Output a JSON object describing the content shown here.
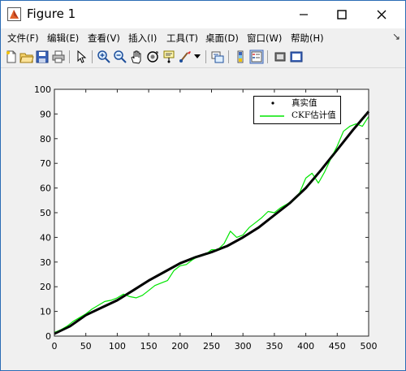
{
  "window": {
    "title": "Figure 1"
  },
  "menu": [
    {
      "label": "文件(F)"
    },
    {
      "label": "编辑(E)"
    },
    {
      "label": "查看(V)"
    },
    {
      "label": "插入(I)"
    },
    {
      "label": "工具(T)"
    },
    {
      "label": "桌面(D)"
    },
    {
      "label": "窗口(W)"
    },
    {
      "label": "帮助(H)"
    }
  ],
  "toolbar_icons": [
    "new-figure-icon",
    "open-file-icon",
    "save-icon",
    "print-icon",
    "pointer-icon",
    "zoom-in-icon",
    "zoom-out-icon",
    "pan-hand-icon",
    "rotate-3d-icon",
    "data-cursor-icon",
    "brush-icon",
    "link-plot-icon",
    "colorbar-icon",
    "legend-icon",
    "hide-plot-tools-icon",
    "show-plot-tools-icon"
  ],
  "colors": {
    "true_series": "#000000",
    "ckf_series": "#00e600",
    "window_border": "#2b6cb5"
  },
  "chart_data": {
    "type": "line",
    "xlim": [
      0,
      500
    ],
    "ylim": [
      0,
      100
    ],
    "x_ticks": [
      0,
      50,
      100,
      150,
      200,
      250,
      300,
      350,
      400,
      450,
      500
    ],
    "y_ticks": [
      0,
      10,
      20,
      30,
      40,
      50,
      60,
      70,
      80,
      90,
      100
    ],
    "legend_position": "top-right",
    "series": [
      {
        "name": "真实值",
        "color": "#000000",
        "marker": "dot",
        "x": [
          0,
          25,
          50,
          75,
          100,
          125,
          150,
          175,
          200,
          225,
          250,
          275,
          300,
          325,
          350,
          375,
          400,
          425,
          450,
          475,
          500
        ],
        "y": [
          1,
          4,
          8.5,
          11.5,
          14.5,
          18.5,
          22.5,
          26,
          29.5,
          32,
          34,
          36.5,
          40,
          44,
          49,
          54,
          60,
          67.5,
          75.5,
          83.5,
          91
        ]
      },
      {
        "name": "CKF估计值",
        "color": "#00e600",
        "marker": "line",
        "x": [
          0,
          10,
          20,
          30,
          40,
          50,
          60,
          70,
          80,
          90,
          100,
          110,
          120,
          130,
          140,
          150,
          160,
          170,
          180,
          190,
          200,
          210,
          220,
          230,
          240,
          250,
          260,
          270,
          280,
          290,
          300,
          310,
          320,
          330,
          340,
          350,
          360,
          370,
          380,
          390,
          400,
          410,
          420,
          430,
          440,
          450,
          460,
          470,
          480,
          490,
          500
        ],
        "y": [
          1.5,
          2.5,
          4,
          6,
          7.5,
          9,
          11,
          12.5,
          14,
          14.5,
          15.5,
          17,
          16,
          15.5,
          16.5,
          18.5,
          20.5,
          21.5,
          22.5,
          26.5,
          28.5,
          29,
          31,
          32.5,
          33,
          35,
          35,
          37.5,
          42.5,
          40,
          41,
          44,
          46,
          48,
          50.5,
          50,
          52,
          53.5,
          55,
          58,
          64,
          66,
          62,
          66.5,
          72,
          77,
          83,
          85,
          86,
          85,
          89
        ]
      }
    ]
  }
}
